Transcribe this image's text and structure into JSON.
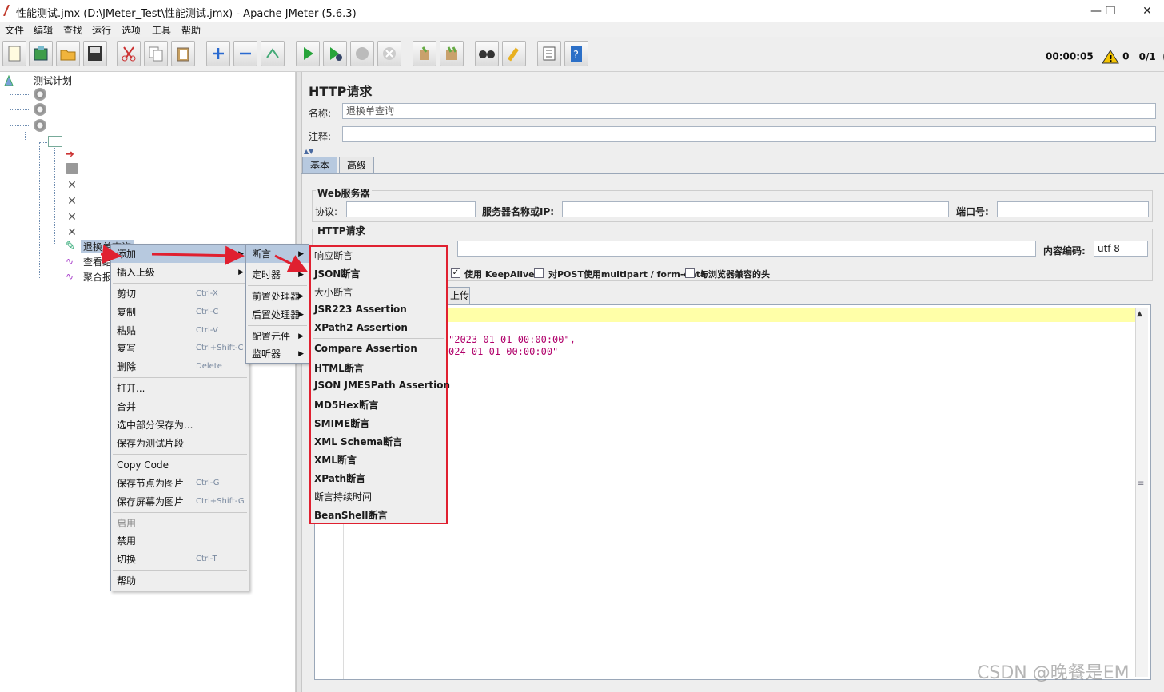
{
  "window": {
    "title": "性能测试.jmx (D:\\JMeter_Test\\性能测试.jmx) - Apache JMeter (5.6.3)",
    "minimize": "—",
    "maximize": "❐",
    "close": "✕"
  },
  "menubar": [
    "文件",
    "编辑",
    "查找",
    "运行",
    "选项",
    "工具",
    "帮助"
  ],
  "toolbar": {
    "timer": "00:00:05",
    "warnings": "0",
    "threads": "0/1"
  },
  "tree": {
    "root": "测试计划",
    "selected": "退换单查询",
    "item2": "查看结果树",
    "item3": "聚合报告"
  },
  "panel": {
    "title": "HTTP请求",
    "name_label": "名称:",
    "name_value": "退换单查询",
    "comment_label": "注释:",
    "tabs": [
      "基本",
      "高级"
    ],
    "web_server": "Web服务器",
    "protocol_label": "协议:",
    "server_label": "服务器名称或IP:",
    "port_label": "端口号:",
    "http_request": "HTTP请求",
    "encoding_label": "内容编码:",
    "encoding_value": "utf-8",
    "keepalive": "使用 KeepAlive",
    "multipart": "对POST使用multipart / form-data",
    "browser_headers": "与浏览器兼容的头",
    "upload_tab_fragment": "上传",
    "body_line1": "\"2023-01-01 00:00:00\",",
    "body_line2": "024-01-01 00:00:00\""
  },
  "context_menu": {
    "items": [
      {
        "label": "添加",
        "shortcut": ""
      },
      {
        "label": "插入上级",
        "shortcut": ""
      },
      {
        "label": "剪切",
        "shortcut": "Ctrl-X"
      },
      {
        "label": "复制",
        "shortcut": "Ctrl-C"
      },
      {
        "label": "粘贴",
        "shortcut": "Ctrl-V"
      },
      {
        "label": "复写",
        "shortcut": "Ctrl+Shift-C"
      },
      {
        "label": "删除",
        "shortcut": "Delete"
      },
      {
        "label": "打开...",
        "shortcut": ""
      },
      {
        "label": "合并",
        "shortcut": ""
      },
      {
        "label": "选中部分保存为...",
        "shortcut": ""
      },
      {
        "label": "保存为测试片段",
        "shortcut": ""
      },
      {
        "label": "Copy Code",
        "shortcut": ""
      },
      {
        "label": "保存节点为图片",
        "shortcut": "Ctrl-G"
      },
      {
        "label": "保存屏幕为图片",
        "shortcut": "Ctrl+Shift-G"
      },
      {
        "label": "启用",
        "shortcut": ""
      },
      {
        "label": "禁用",
        "shortcut": ""
      },
      {
        "label": "切换",
        "shortcut": "Ctrl-T"
      },
      {
        "label": "帮助",
        "shortcut": ""
      }
    ]
  },
  "add_submenu": [
    "断言",
    "定时器",
    "前置处理器",
    "后置处理器",
    "配置元件",
    "监听器"
  ],
  "assertions": [
    "响应断言",
    "JSON断言",
    "大小断言",
    "JSR223 Assertion",
    "XPath2 Assertion",
    "Compare Assertion",
    "HTML断言",
    "JSON JMESPath Assertion",
    "MD5Hex断言",
    "SMIME断言",
    "XML Schema断言",
    "XML断言",
    "XPath断言",
    "断言持续时间",
    "BeanShell断言"
  ],
  "watermark": "CSDN @晚餐是EM",
  "colors": {
    "highlight": "#b7c9df",
    "annotation_red": "#e02030",
    "code": "#b0006a"
  }
}
